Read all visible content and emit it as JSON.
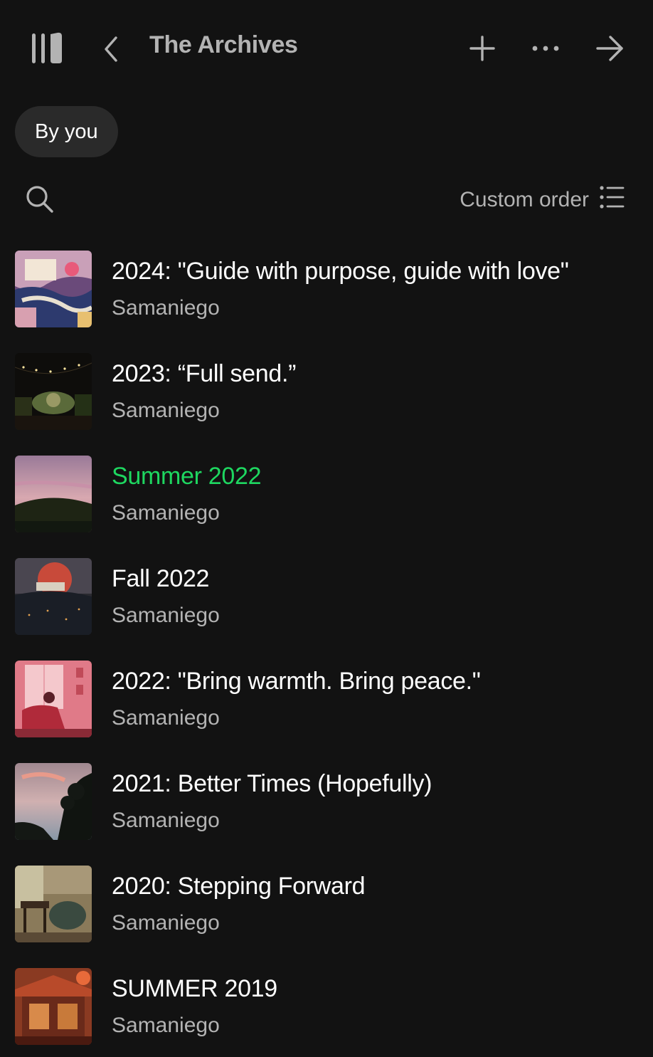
{
  "header": {
    "title": "The Archives"
  },
  "filters": {
    "chip_label": "By you"
  },
  "toolbar": {
    "sort_label": "Custom order"
  },
  "colors": {
    "background": "#121212",
    "accent": "#1ed760",
    "text_primary": "#ffffff",
    "text_secondary": "#b3b3b3",
    "chip_bg": "#2a2a2a"
  },
  "icons": {
    "library": "library-icon",
    "back": "chevron-left-icon",
    "add": "plus-icon",
    "more": "more-horizontal-icon",
    "forward": "arrow-right-icon",
    "search": "search-icon",
    "sort": "list-icon"
  },
  "playlists": [
    {
      "title": "2024: \"Guide with purpose, guide with love\"",
      "subtitle": "Samaniego",
      "active": false
    },
    {
      "title": "2023: “Full send.”",
      "subtitle": "Samaniego",
      "active": false
    },
    {
      "title": "Summer 2022",
      "subtitle": "Samaniego",
      "active": true
    },
    {
      "title": "Fall 2022",
      "subtitle": "Samaniego",
      "active": false
    },
    {
      "title": "2022: \"Bring warmth. Bring peace.\"",
      "subtitle": "Samaniego",
      "active": false
    },
    {
      "title": "2021: Better Times (Hopefully)",
      "subtitle": "Samaniego",
      "active": false
    },
    {
      "title": "2020: Stepping Forward",
      "subtitle": "Samaniego",
      "active": false
    },
    {
      "title": "SUMMER 2019",
      "subtitle": "Samaniego",
      "active": false
    }
  ]
}
